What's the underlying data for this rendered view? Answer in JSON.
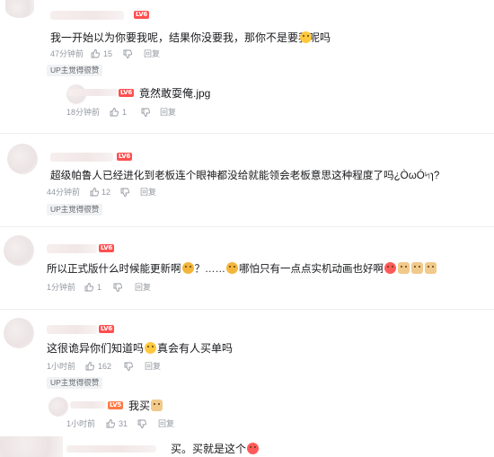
{
  "comments": [
    {
      "level": "LV6",
      "text": "我一开始以为你要我呢，结果你没要我，那你不是要我呢吗",
      "time": "47分钟前",
      "likes": "15",
      "reply": "回复",
      "badge": "UP主觉得很赞",
      "replies": [
        {
          "level": "LV6",
          "text": "竟然敢耍俺.jpg",
          "time": "18分钟前",
          "likes": "1",
          "reply": "回复"
        }
      ]
    },
    {
      "level": "LV6",
      "text": "超级帕鲁人已经进化到老板连个眼神都没给就能领会老板意思这种程度了吗¿ÒωÓ৸ɿ?",
      "time": "44分钟前",
      "likes": "12",
      "reply": "回复",
      "badge": "UP主觉得很赞"
    },
    {
      "level": "LV6",
      "text_a": "所以正式版什么时候能更新啊",
      "text_b": "？……",
      "text_c": "哪怕只有一点点实机动画也好啊",
      "time": "1分钟前",
      "likes": "1",
      "reply": "回复"
    },
    {
      "level": "LV6",
      "text_a": "这很诡异你们知道吗",
      "text_b": "真会有人买单吗",
      "time": "1小时前",
      "likes": "162",
      "reply": "回复",
      "badge": "UP主觉得很赞",
      "replies": [
        {
          "level": "LV5",
          "text": "我买",
          "time": "1小时前",
          "likes": "31",
          "reply": "回复"
        }
      ]
    }
  ],
  "bottom_text": "买。买就是这个",
  "icons": [
    "thumb-up-icon",
    "thumb-down-icon",
    "emoji-icon"
  ]
}
